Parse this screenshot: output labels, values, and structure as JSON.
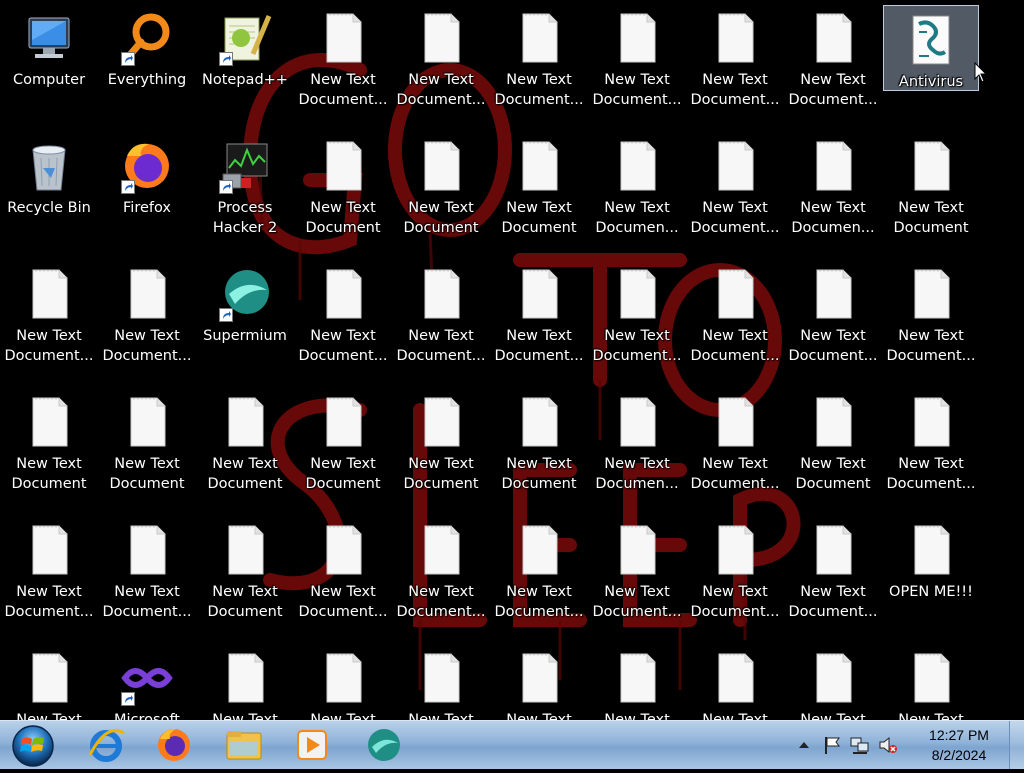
{
  "desktop": {
    "icons": [
      {
        "label": "Computer",
        "icon": "computer-icon",
        "shortcut": false
      },
      {
        "label": "Everything",
        "icon": "everything-icon",
        "shortcut": true
      },
      {
        "label": "Notepad++",
        "icon": "notepadpp-icon",
        "shortcut": true
      },
      {
        "label": "New Text Document...",
        "icon": "text-file-icon",
        "shortcut": false
      },
      {
        "label": "New Text Document...",
        "icon": "text-file-icon",
        "shortcut": false
      },
      {
        "label": "New Text Document...",
        "icon": "text-file-icon",
        "shortcut": false
      },
      {
        "label": "New Text Document...",
        "icon": "text-file-icon",
        "shortcut": false
      },
      {
        "label": "New Text Document....",
        "icon": "text-file-icon",
        "shortcut": false
      },
      {
        "label": "New Text Document...",
        "icon": "text-file-icon",
        "shortcut": false
      },
      {
        "label": "Antivirus",
        "icon": "script-icon",
        "shortcut": false,
        "selected": true
      },
      {
        "label": "Recycle Bin",
        "icon": "recycle-bin-icon",
        "shortcut": false
      },
      {
        "label": "Firefox",
        "icon": "firefox-icon",
        "shortcut": true
      },
      {
        "label": "Process Hacker 2",
        "icon": "process-hacker-icon",
        "shortcut": true
      },
      {
        "label": "New Text Document (...",
        "icon": "text-file-icon",
        "shortcut": false
      },
      {
        "label": "New Text Document (...",
        "icon": "text-file-icon",
        "shortcut": false
      },
      {
        "label": "New Text Document (...",
        "icon": "text-file-icon",
        "shortcut": false
      },
      {
        "label": "New Text Documen...",
        "icon": "text-file-icon",
        "shortcut": false
      },
      {
        "label": "New Text Document....",
        "icon": "text-file-icon",
        "shortcut": false
      },
      {
        "label": "New Text Documen...",
        "icon": "text-file-icon",
        "shortcut": false
      },
      {
        "label": "New Text Document ...",
        "icon": "text-file-icon",
        "shortcut": false
      },
      {
        "label": "New Text Document...",
        "icon": "text-file-icon",
        "shortcut": false
      },
      {
        "label": "New Text Document...",
        "icon": "text-file-icon",
        "shortcut": false
      },
      {
        "label": "Supermium",
        "icon": "supermium-icon",
        "shortcut": true
      },
      {
        "label": "New Text Document...",
        "icon": "text-file-icon",
        "shortcut": false
      },
      {
        "label": "New Text Document...",
        "icon": "text-file-icon",
        "shortcut": false
      },
      {
        "label": "New Text Document...",
        "icon": "text-file-icon",
        "shortcut": false
      },
      {
        "label": "New Text Document...",
        "icon": "text-file-icon",
        "shortcut": false
      },
      {
        "label": "New Text Document...",
        "icon": "text-file-icon",
        "shortcut": false
      },
      {
        "label": "New Text Document....",
        "icon": "text-file-icon",
        "shortcut": false
      },
      {
        "label": "New Text Document...",
        "icon": "text-file-icon",
        "shortcut": false
      },
      {
        "label": "New Text Document ...",
        "icon": "text-file-icon",
        "shortcut": false
      },
      {
        "label": "New Text Document ...",
        "icon": "text-file-icon",
        "shortcut": false
      },
      {
        "label": "New Text Document",
        "icon": "text-file-icon",
        "shortcut": false
      },
      {
        "label": "New Text Document (...",
        "icon": "text-file-icon",
        "shortcut": false
      },
      {
        "label": "New Text Document (...",
        "icon": "text-file-icon",
        "shortcut": false
      },
      {
        "label": "New Text Document (...",
        "icon": "text-file-icon",
        "shortcut": false
      },
      {
        "label": "New Text Documen...",
        "icon": "text-file-icon",
        "shortcut": false
      },
      {
        "label": "New Text Document....",
        "icon": "text-file-icon",
        "shortcut": false
      },
      {
        "label": "New Text Document ...",
        "icon": "text-file-icon",
        "shortcut": false
      },
      {
        "label": "New Text Document...",
        "icon": "text-file-icon",
        "shortcut": false
      },
      {
        "label": "New Text Document...",
        "icon": "text-file-icon",
        "shortcut": false
      },
      {
        "label": "New Text Document...",
        "icon": "text-file-icon",
        "shortcut": false
      },
      {
        "label": "New Text Document ...",
        "icon": "text-file-icon",
        "shortcut": false
      },
      {
        "label": "New Text Document...",
        "icon": "text-file-icon",
        "shortcut": false
      },
      {
        "label": "New Text Document...",
        "icon": "text-file-icon",
        "shortcut": false
      },
      {
        "label": "New Text Document...",
        "icon": "text-file-icon",
        "shortcut": false
      },
      {
        "label": "New Text Document...",
        "icon": "text-file-icon",
        "shortcut": false
      },
      {
        "label": "New Text Document....",
        "icon": "text-file-icon",
        "shortcut": false
      },
      {
        "label": "New Text Document...",
        "icon": "text-file-icon",
        "shortcut": false
      },
      {
        "label": "OPEN ME!!!",
        "icon": "text-file-icon",
        "shortcut": false
      },
      {
        "label": "New Text",
        "icon": "text-file-icon",
        "shortcut": false
      },
      {
        "label": "Microsoft",
        "icon": "visual-studio-icon",
        "shortcut": true
      },
      {
        "label": "New Text",
        "icon": "text-file-icon",
        "shortcut": false
      },
      {
        "label": "New Text",
        "icon": "text-file-icon",
        "shortcut": false
      },
      {
        "label": "New Text",
        "icon": "text-file-icon",
        "shortcut": false
      },
      {
        "label": "New Text",
        "icon": "text-file-icon",
        "shortcut": false
      },
      {
        "label": "New Text",
        "icon": "text-file-icon",
        "shortcut": false
      },
      {
        "label": "New Text",
        "icon": "text-file-icon",
        "shortcut": false
      },
      {
        "label": "New Text",
        "icon": "text-file-icon",
        "shortcut": false
      },
      {
        "label": "New Text",
        "icon": "text-file-icon",
        "shortcut": false
      }
    ]
  },
  "wallpaper": {
    "text": "GO TO SLEEP",
    "color": "#8b0a0a"
  },
  "taskbar": {
    "start": "start-orb-icon",
    "pinned": [
      "internet-explorer-icon",
      "firefox-icon",
      "file-explorer-icon",
      "media-player-icon",
      "supermium-icon"
    ],
    "tray": [
      "show-hidden-icons-icon",
      "action-center-flag-icon",
      "network-icon",
      "volume-muted-icon"
    ],
    "clock": {
      "time": "12:27 PM",
      "date": "8/2/2024"
    }
  }
}
